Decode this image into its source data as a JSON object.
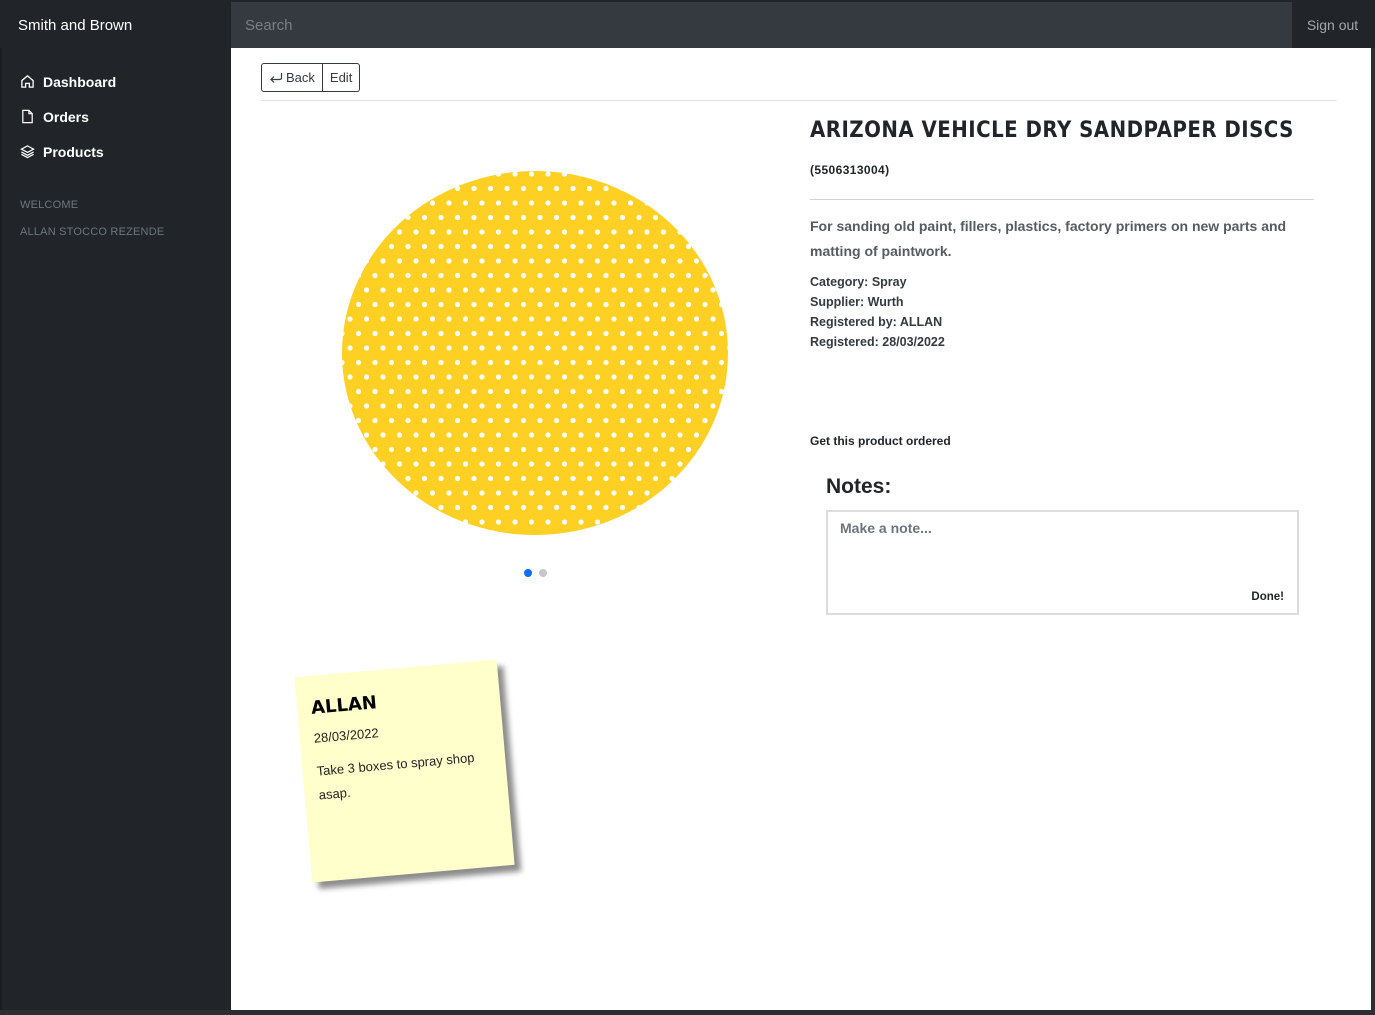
{
  "app": {
    "brand": "Smith and Brown",
    "sign_out": "Sign out"
  },
  "search": {
    "placeholder": "Search"
  },
  "sidebar": {
    "items": [
      {
        "label": "Dashboard",
        "icon": "home-icon"
      },
      {
        "label": "Orders",
        "icon": "file-icon"
      },
      {
        "label": "Products",
        "icon": "layers-icon"
      }
    ],
    "welcome_heading": "WELCOME",
    "user_name": "ALLAN STOCCO REZENDE"
  },
  "toolbar": {
    "back_label": "Back",
    "edit_label": "Edit"
  },
  "product": {
    "title": "ARIZONA VEHICLE DRY SANDPAPER DISCS",
    "code": "(5506313004)",
    "description": "For sanding old paint, fillers, plastics, factory primers on new parts and matting of paintwork.",
    "category": "Category: Spray",
    "supplier": "Supplier: Wurth",
    "registered_by": "Registered by: ALLAN",
    "registered": "Registered: 28/03/2022",
    "order_link": "Get this product ordered",
    "image_color": "#fdd023"
  },
  "carousel": {
    "slides": 2,
    "active": 1
  },
  "notes": {
    "title": "Notes:",
    "placeholder": "Make a note...",
    "done_label": "Done!"
  },
  "sticky_note": {
    "author": "ALLAN",
    "date": "28/03/2022",
    "text": "Take 3 boxes to spray shop asap.",
    "color": "#ffffcc"
  },
  "colors": {
    "sidebar_bg": "#212529",
    "topbar_bg": "#343a40",
    "carousel_active": "#0d6efd"
  }
}
